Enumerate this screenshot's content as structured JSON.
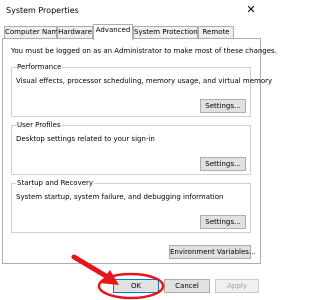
{
  "window": {
    "title": "System Properties",
    "close_glyph": "✕"
  },
  "tabs": [
    {
      "label": "Computer Name"
    },
    {
      "label": "Hardware"
    },
    {
      "label": "Advanced",
      "active": true
    },
    {
      "label": "System Protection"
    },
    {
      "label": "Remote"
    }
  ],
  "main": {
    "intro": "You must be logged on as an Administrator to make most of these changes.",
    "performance": {
      "title": "Performance",
      "description": "Visual effects, processor scheduling, memory usage, and virtual memory",
      "button": "Settings..."
    },
    "user_profiles": {
      "title": "User Profiles",
      "description": "Desktop settings related to your sign-in",
      "button": "Settings..."
    },
    "startup_recovery": {
      "title": "Startup and Recovery",
      "description": "System startup, system failure, and debugging information",
      "button": "Settings..."
    },
    "env_button": "Environment Variables..."
  },
  "footer": {
    "ok": "OK",
    "cancel": "Cancel",
    "apply": "Apply"
  },
  "annotation": {
    "color": "#e8141c"
  }
}
